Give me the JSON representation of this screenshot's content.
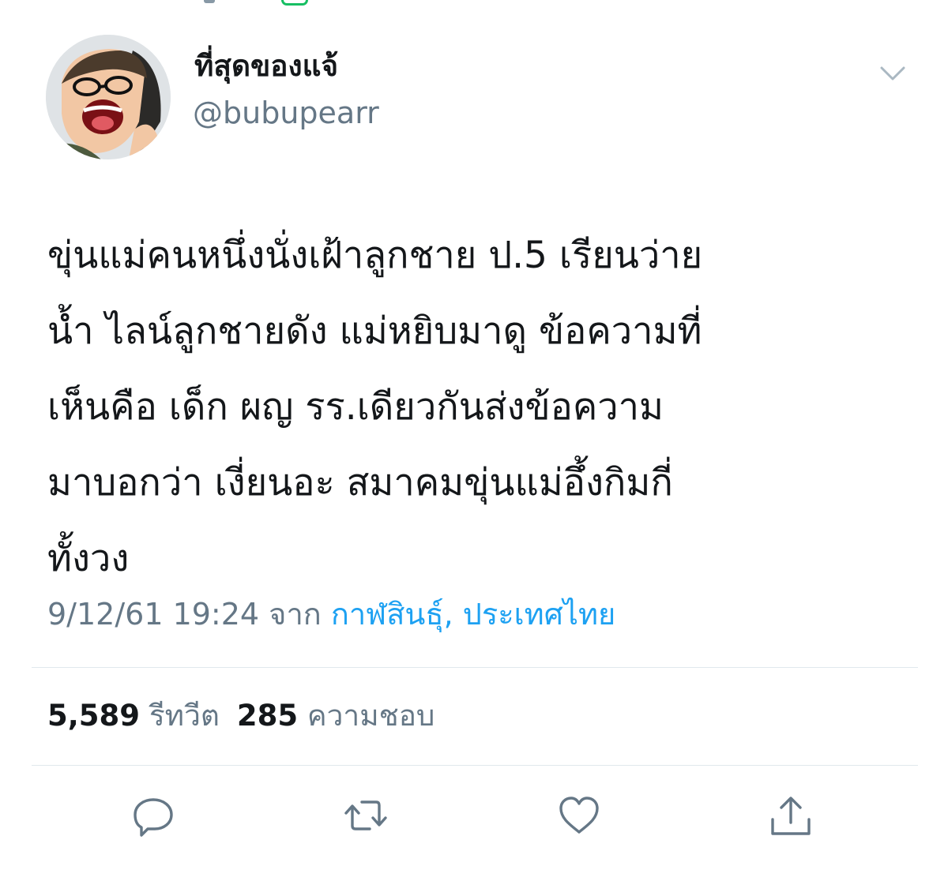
{
  "tweet": {
    "display_name": "ที่สุดของแจ้",
    "handle": "@bubupearr",
    "text": "ขุ่นแม่คนหนึ่งนั่งเฝ้าลูกชาย ป.5 เรียนว่าย\nน้ำ ไลน์ลูกชายดัง แม่หยิบมาดู ข้อความที่\nเห็นคือ เด็ก ผญ รร.เดียวกันส่งข้อความ\nมาบอกว่า เงี่ยนอะ สมาคมขุ่นแม่อึ้งกิมกี่\nทั้งวง",
    "date_time": "9/12/61 19:24",
    "from_label": "จาก",
    "location": "กาฬสินธุ์, ประเทศไทย"
  },
  "stats": {
    "retweets_count": "5,589",
    "retweets_label": "รีทวีต",
    "likes_count": "285",
    "likes_label": "ความชอบ"
  },
  "colors": {
    "text": "#14171a",
    "secondary": "#657786",
    "link": "#1da1f2",
    "divider": "#e1e8ed",
    "icon": "#657786"
  },
  "icons": {
    "menu": "chevron-down-icon",
    "reply": "reply-icon",
    "retweet": "retweet-icon",
    "like": "heart-icon",
    "share": "share-icon"
  }
}
